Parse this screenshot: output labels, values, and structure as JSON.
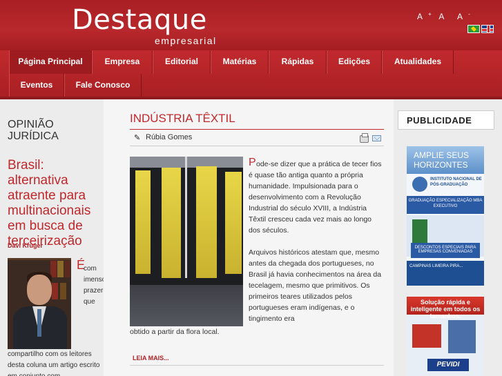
{
  "header": {
    "logo_main": "Destaque",
    "logo_sub": "empresarial",
    "font_controls": [
      "A",
      "A",
      "A"
    ],
    "font_control_marks": [
      "+",
      "",
      "-"
    ],
    "flags": [
      "brazil-flag",
      "uk-flag"
    ]
  },
  "nav": {
    "items": [
      "Página Principal",
      "Empresa",
      "Editorial",
      "Matérias",
      "Rápidas",
      "Edições",
      "Atualidades",
      "Eventos",
      "Fale Conosco"
    ],
    "active": "Página Principal"
  },
  "opiniao": {
    "section_title": "OPINIÃO JURÍDICA",
    "heading": "Brasil: alternativa atraente para multinacionais em busca de terceirização",
    "author": "Davi Kruger",
    "dropcap": "É",
    "text_side": "com imenso prazer que",
    "text_bottom": "compartilho com os leitores desta coluna um artigo escrito em conjunto com"
  },
  "article": {
    "title": "INDÚSTRIA TÊXTIL",
    "author": "Rúbia Gomes",
    "dropcap": "P",
    "text": "ode-se dizer que a prática de tecer fios é quase tão antiga quanto a própria humanidade. Impulsionada para o desenvolvimento com a Revolução Industrial do século XVIII, a Indústria Têxtil cresceu cada vez mais ao longo dos séculos.\n\nArquivos históricos atestam que, mesmo antes da chegada dos portugueses, no Brasil já havia conhecimentos na área da tecelagem, mesmo que primitivos. Os primeiros teares utilizados pelos portugueses eram indígenas, e o tingimento era",
    "text_tail": "obtido a partir da flora local.",
    "read_more": "LEIA MAIS..."
  },
  "sidebar": {
    "title": "PUBLICIDADE",
    "ad1": {
      "headline": "AMPLIE SEUS HORIZONTES",
      "institute": "INSTITUTO NACIONAL DE PÓS-GRADUAÇÃO",
      "band": "GRADUAÇÃO ESPECIALIZAÇÃO MBA EXECUTIVO",
      "discount": "DESCONTOS ESPECIAIS PARA EMPRESAS CONVENIADAS",
      "cities": "CAMPINAS  LIMEIRA  PIRA..."
    },
    "ad2": {
      "headline": "Solução rápida e inteligente em todos os tamanhos.",
      "brand": "PEVIDI"
    }
  }
}
